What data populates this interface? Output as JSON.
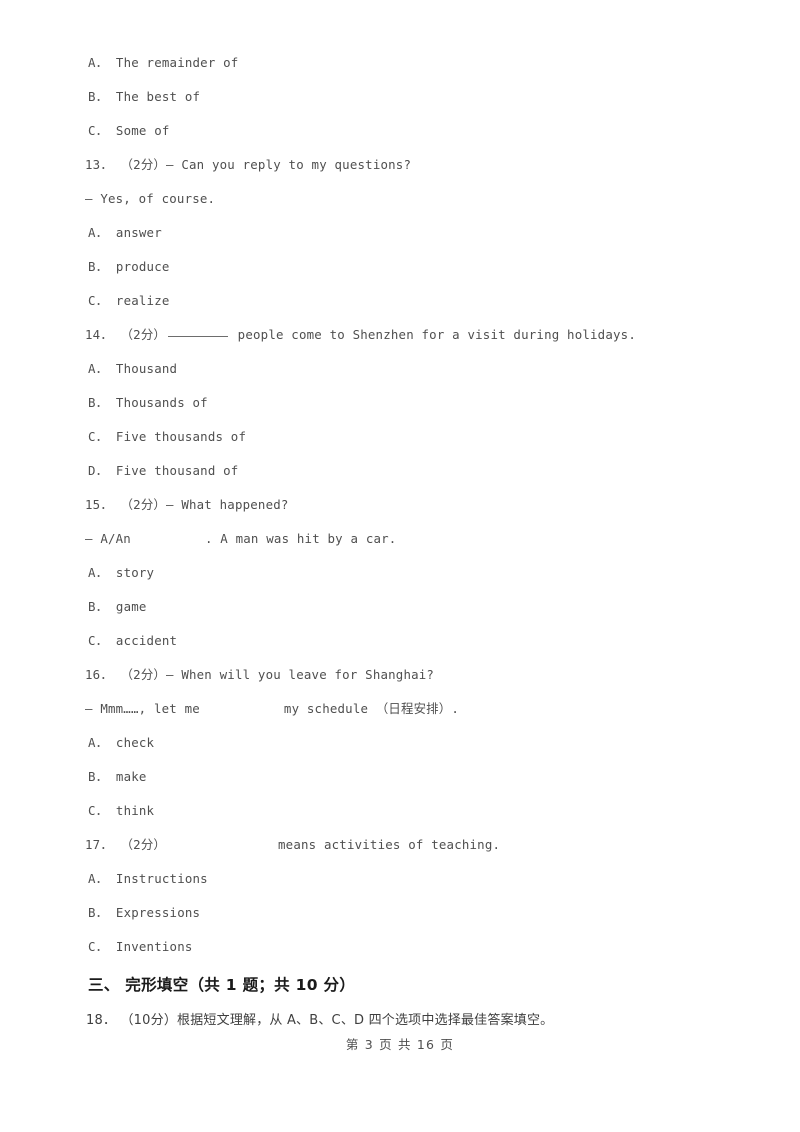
{
  "document": {
    "body_lines": [
      {
        "id": "opt-12-a",
        "kind": "option",
        "text": "A． The remainder of"
      },
      {
        "id": "opt-12-b",
        "kind": "option",
        "text": "B． The best of"
      },
      {
        "id": "opt-12-c",
        "kind": "option",
        "text": "C． Some of"
      },
      {
        "id": "q13-stem",
        "kind": "question",
        "text": "13． （2分）— Can you reply to my questions?"
      },
      {
        "id": "q13-reply",
        "kind": "question-cont",
        "text": "— Yes, of course."
      },
      {
        "id": "opt-13-a",
        "kind": "option",
        "text": "A． answer"
      },
      {
        "id": "opt-13-b",
        "kind": "option",
        "text": "B． produce"
      },
      {
        "id": "opt-13-c",
        "kind": "option",
        "text": "C． realize"
      },
      {
        "id": "q14-stem",
        "kind": "question-blank-underline",
        "prefix": "14． （2分）",
        "suffix": " people come to Shenzhen for a visit during holidays."
      },
      {
        "id": "opt-14-a",
        "kind": "option",
        "text": "A． Thousand"
      },
      {
        "id": "opt-14-b",
        "kind": "option",
        "text": "B． Thousands of"
      },
      {
        "id": "opt-14-c",
        "kind": "option",
        "text": "C． Five thousands of"
      },
      {
        "id": "opt-14-d",
        "kind": "option",
        "text": "D． Five thousand of"
      },
      {
        "id": "q15-stem",
        "kind": "question",
        "text": "15． （2分）— What happened?"
      },
      {
        "id": "q15-reply",
        "kind": "question-blank-gap-15",
        "prefix": "— A/An",
        "suffix": ". A man was hit by a car."
      },
      {
        "id": "opt-15-a",
        "kind": "option",
        "text": "A． story"
      },
      {
        "id": "opt-15-b",
        "kind": "option",
        "text": "B． game"
      },
      {
        "id": "opt-15-c",
        "kind": "option",
        "text": "C． accident"
      },
      {
        "id": "q16-stem",
        "kind": "question",
        "text": "16． （2分）— When will you leave for Shanghai?"
      },
      {
        "id": "q16-reply",
        "kind": "question-blank-gap-16",
        "prefix": "— Mmm……, let me",
        "suffix": "my schedule （日程安排）."
      },
      {
        "id": "opt-16-a",
        "kind": "option",
        "text": "A． check"
      },
      {
        "id": "opt-16-b",
        "kind": "option",
        "text": "B． make"
      },
      {
        "id": "opt-16-c",
        "kind": "option",
        "text": "C． think"
      },
      {
        "id": "q17-stem",
        "kind": "question-blank-gap-17",
        "prefix": "17． （2分）",
        "suffix": "means activities of teaching."
      },
      {
        "id": "opt-17-a",
        "kind": "option",
        "text": "A． Instructions"
      },
      {
        "id": "opt-17-b",
        "kind": "option",
        "text": "B． Expressions"
      },
      {
        "id": "opt-17-c",
        "kind": "option",
        "text": "C． Inventions"
      }
    ],
    "section_heading": "三、 完形填空（共 1 题；共 10 分）",
    "item_18": "18． （10分）根据短文理解，从 A、B、C、D 四个选项中选择最佳答案填空。",
    "footer": "第 3 页 共 16 页"
  }
}
